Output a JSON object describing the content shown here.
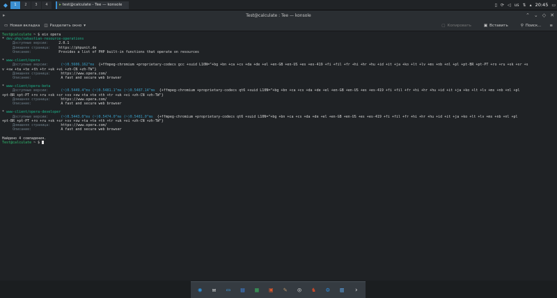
{
  "panel": {
    "desktops": [
      "1",
      "2",
      "3",
      "4"
    ],
    "active_desktop": 1,
    "task_label": "test@calculate - Tee — konsole",
    "tray": {
      "lang": "us",
      "clock": "20:45"
    }
  },
  "window": {
    "title": "Test@calculate : Tee — konsole",
    "toolbar": {
      "new_tab": "Новая вкладка",
      "split_view": "Разделить окно",
      "copy": "Копировать",
      "paste": "Вставить",
      "find": "Поиск..."
    }
  },
  "terminal": {
    "lines": [
      [
        [
          "g",
          "Test@calculate"
        ],
        [
          "w",
          " ~ $ "
        ],
        [
          "w",
          "eix opera"
        ]
      ],
      [
        [
          "w",
          "* "
        ],
        [
          "gr",
          "dev-php/sebastian-resource-operations"
        ]
      ],
      [
        [
          "w",
          "     "
        ],
        [
          "dm",
          "Доступные версии:     "
        ],
        [
          "w",
          "2.0.1"
        ]
      ],
      [
        [
          "w",
          "     "
        ],
        [
          "dm",
          "Домашняя страница:    "
        ],
        [
          "w",
          "https://phpunit.de"
        ]
      ],
      [
        [
          "w",
          "     "
        ],
        [
          "dm",
          "Описание:             "
        ],
        [
          "w",
          "Provides a list of PHP built-in functions that operate on resources"
        ]
      ],
      [
        [
          "w",
          ""
        ]
      ],
      [
        [
          "w",
          "* "
        ],
        [
          "gr",
          "www-client/opera"
        ]
      ],
      [
        [
          "w",
          "     "
        ],
        [
          "dm",
          "Доступные версии:      "
        ],
        [
          "c",
          "(~)0.5606.162^ms"
        ],
        [
          "w",
          "  {+ffmpeg-chromium +proprietary-codecs gcc +suid L10N=\"+bg +bn +ca +cs +da +de +el +en-GB +en-US +es +es-419 +fi +fil +fr +hi +hr +hu +id +it +ja +ko +lt +lv +ms +nb +nl +pl +pt-BR +pt-PT +ro +ru +sk +sr +s"
        ]
      ],
      [
        [
          "w",
          "v +sw +ta +te +th +tr +uk +vi +zh-CN +zh-TW\"}"
        ]
      ],
      [
        [
          "w",
          "     "
        ],
        [
          "dm",
          "Домашняя страница:     "
        ],
        [
          "w",
          "https://www.opera.com/"
        ]
      ],
      [
        [
          "w",
          "     "
        ],
        [
          "dm",
          "Описание:              "
        ],
        [
          "w",
          "A fast and secure web browser"
        ]
      ],
      [
        [
          "w",
          ""
        ]
      ],
      [
        [
          "w",
          "* "
        ],
        [
          "gr",
          "www-client/opera-beta"
        ]
      ],
      [
        [
          "w",
          "     "
        ],
        [
          "dm",
          "Доступные версии:      "
        ],
        [
          "c",
          "(~)0.5449.4^ms (~)0.5481.1^ms (~)0.5487.14^ms"
        ],
        [
          "w",
          "  {+ffmpeg-chromium +proprietary-codecs qt6 +suid L10N=\"+bg +bn +ca +cs +da +de +el +en-GB +en-US +es +es-419 +fi +fil +fr +hi +hr +hu +id +it +ja +ko +lt +lv +ms +nb +nl +pl"
        ]
      ],
      [
        [
          "w",
          "+pt-BR +pt-PT +ro +ru +sk +sr +sv +sw +ta +te +th +tr +uk +vi +zh-CN +zh-TW\"}"
        ]
      ],
      [
        [
          "w",
          "     "
        ],
        [
          "dm",
          "Домашняя страница:     "
        ],
        [
          "w",
          "https://www.opera.com/"
        ]
      ],
      [
        [
          "w",
          "     "
        ],
        [
          "dm",
          "Описание:              "
        ],
        [
          "w",
          "A fast and secure web browser"
        ]
      ],
      [
        [
          "w",
          ""
        ]
      ],
      [
        [
          "w",
          "* "
        ],
        [
          "gr",
          "www-client/opera-developer"
        ]
      ],
      [
        [
          "w",
          "     "
        ],
        [
          "dm",
          "Доступные версии:      "
        ],
        [
          "c",
          "(~)0.5443.0^ms (~)0.5474.0^ms (~)0.5481.0^ms"
        ],
        [
          "w",
          "  {+ffmpeg-chromium +proprietary-codecs qt6 +suid L10N=\"+bg +bn +ca +cs +da +de +el +en-GB +en-US +es +es-419 +fi +fil +fr +hi +hr +hu +id +it +ja +ko +lt +lv +ms +nb +nl +pl"
        ]
      ],
      [
        [
          "w",
          "+pt-BR +pt-PT +ro +ru +sk +sr +sv +sw +ta +te +th +tr +uk +vi +zh-CN +zh-TW\"}"
        ]
      ],
      [
        [
          "w",
          "     "
        ],
        [
          "dm",
          "Домашняя страница:     "
        ],
        [
          "w",
          "https://www.opera.com/"
        ]
      ],
      [
        [
          "w",
          "     "
        ],
        [
          "dm",
          "Описание:              "
        ],
        [
          "w",
          "A fast and secure web browser"
        ]
      ],
      [
        [
          "w",
          ""
        ]
      ],
      [
        [
          "w",
          "Найдено 4 совпадения."
        ]
      ],
      [
        [
          "g",
          "Test@calculate"
        ],
        [
          "w",
          " ~ $ "
        ]
      ]
    ]
  },
  "dock": {
    "icons": [
      {
        "name": "browser-icon",
        "color": "#2d8fd8",
        "glyph": "◉"
      },
      {
        "name": "mail-icon",
        "color": "#e6e6e6",
        "glyph": "✉"
      },
      {
        "name": "chat-icon",
        "color": "#3d9be0",
        "glyph": "▭"
      },
      {
        "name": "document-icon",
        "color": "#3d7fd8",
        "glyph": "▤"
      },
      {
        "name": "spreadsheet-icon",
        "color": "#3aa35a",
        "glyph": "▦"
      },
      {
        "name": "presentation-icon",
        "color": "#d9572c",
        "glyph": "▣"
      },
      {
        "name": "paint-icon",
        "color": "#b9956a",
        "glyph": "✎"
      },
      {
        "name": "disc-icon",
        "color": "#d8d8d8",
        "glyph": "◎"
      },
      {
        "name": "game-icon",
        "color": "#c94a2a",
        "glyph": "♞"
      },
      {
        "name": "settings-icon",
        "color": "#2f89d6",
        "glyph": "⚙"
      },
      {
        "name": "files-icon",
        "color": "#5aa0e0",
        "glyph": "▥"
      },
      {
        "name": "terminal-icon",
        "color": "#e0e0e0",
        "glyph": "›"
      }
    ]
  }
}
